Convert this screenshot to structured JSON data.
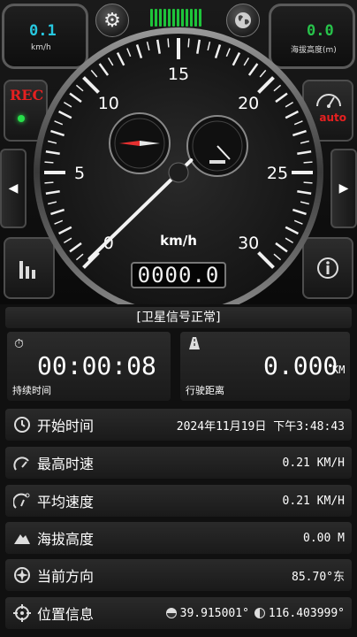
{
  "header": {
    "speed_value": "0.1",
    "speed_unit": "km/h",
    "altitude_value": "0.0",
    "altitude_unit": "海拔高度(m)",
    "rec_label": "REC",
    "auto_label": "auto",
    "icons": [
      "settings-gear-icon",
      "globe-icon",
      "signal-bars-icon",
      "speedometer-icon",
      "bar-chart-icon",
      "info-icon",
      "arrow-left-icon",
      "arrow-right-icon"
    ]
  },
  "gauge": {
    "unit": "km/h",
    "ticks": [
      "0",
      "5",
      "10",
      "15",
      "20",
      "25",
      "30"
    ],
    "max": 30,
    "current_speed": 0.1,
    "odometer": "0000.0"
  },
  "status": {
    "text": "[卫星信号正常]"
  },
  "cards": {
    "duration_value": "00:00:08",
    "duration_label": "持续时间",
    "distance_value": "0.000",
    "distance_unit": "KM",
    "distance_label": "行驶距离"
  },
  "rows": [
    {
      "label": "开始时间",
      "value": "2024年11月19日 下午3:48:43",
      "icon": "clock-icon"
    },
    {
      "label": "最高时速",
      "value": "0.21 KM/H",
      "icon": "max-speed-icon"
    },
    {
      "label": "平均速度",
      "value": "0.21 KM/H",
      "icon": "avg-speed-icon"
    },
    {
      "label": "海拔高度",
      "value": "0.00 M",
      "icon": "mountain-icon"
    },
    {
      "label": "当前方向",
      "value": "85.70°东",
      "icon": "compass-icon"
    },
    {
      "label": "位置信息",
      "value_lat": "39.915001°",
      "value_lon": "116.403999°",
      "icon": "crosshair-icon"
    }
  ],
  "colors": {
    "speed": "#27c8e0",
    "altitude": "#27c24a",
    "rec": "#e62020",
    "signal": "#1ec43a"
  }
}
